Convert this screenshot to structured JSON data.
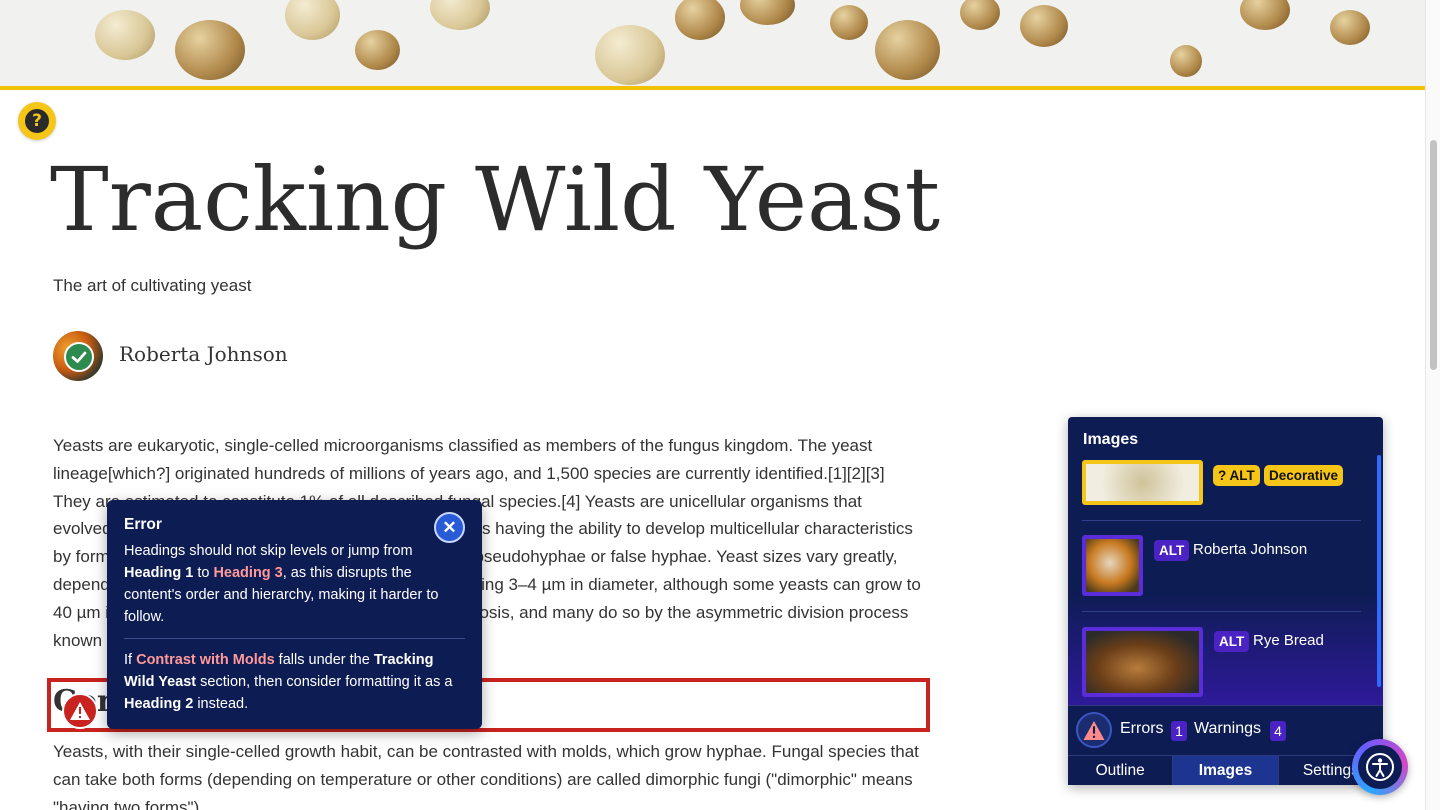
{
  "article": {
    "title": "Tracking Wild Yeast",
    "subtitle": "The art of cultivating yeast",
    "author": "Roberta Johnson",
    "paragraph1": "Yeasts are eukaryotic, single-celled microorganisms classified as members of the fungus kingdom. The yeast lineage[which?] originated hundreds of millions of years ago, and 1,500 species are currently identified.[1][2][3] They are estimated to constitute 1% of all described fungal species.[4] Yeasts are unicellular organisms that evolved from multicellular ancestors,[5] with some species having the ability to develop multicellular characteristics by forming strings of connected budding cells known as pseudohyphae or false hyphae. Yeast sizes vary greatly, depending on species and environment, typically measuring 3–4 µm in diameter, although some yeasts can grow to 40 µm in size.[7] Most yeasts reproduce asexually by mitosis, and many do so by the asymmetric division process known as budding.",
    "heading": "Contrast with Molds",
    "paragraph2": "Yeasts, with their single-celled growth habit, can be contrasted with molds, which grow hyphae. Fungal species that can take both forms (depending on temperature or other conditions) are called dimorphic fungi (\"dimorphic\" means \"having two forms\")."
  },
  "tooltip": {
    "title": "Error",
    "line1_a": "Headings should not skip levels or jump from ",
    "line1_h1": "Heading 1",
    "line1_to": " to ",
    "line1_h3": "Heading 3",
    "line1_b": ", as this disrupts the content's order and hierarchy, making it harder to follow.",
    "line2_a": "If ",
    "line2_heading": "Contrast with Molds",
    "line2_b": " falls under the ",
    "line2_section": "Tracking Wild Yeast",
    "line2_c": " section, then consider formatting it as a ",
    "line2_h2": "Heading 2",
    "line2_d": " instead.",
    "close_symbol": "✕"
  },
  "panel": {
    "title": "Images",
    "items": [
      {
        "badges": [
          "? ALT",
          "Decorative"
        ]
      },
      {
        "badge": "ALT",
        "alt": "Roberta Johnson"
      },
      {
        "badge": "ALT",
        "alt": "Rye Bread"
      }
    ],
    "errors_label": "Errors",
    "errors_count": "1",
    "warnings_label": "Warnings",
    "warnings_count": "4",
    "tabs": [
      "Outline",
      "Images",
      "Settings"
    ],
    "active_tab": "Images"
  },
  "help_symbol": "?",
  "colors": {
    "accent_yellow": "#f5c518",
    "error_red": "#c9231f",
    "panel_navy": "#0e1c54",
    "badge_purple": "#4b22c4"
  }
}
